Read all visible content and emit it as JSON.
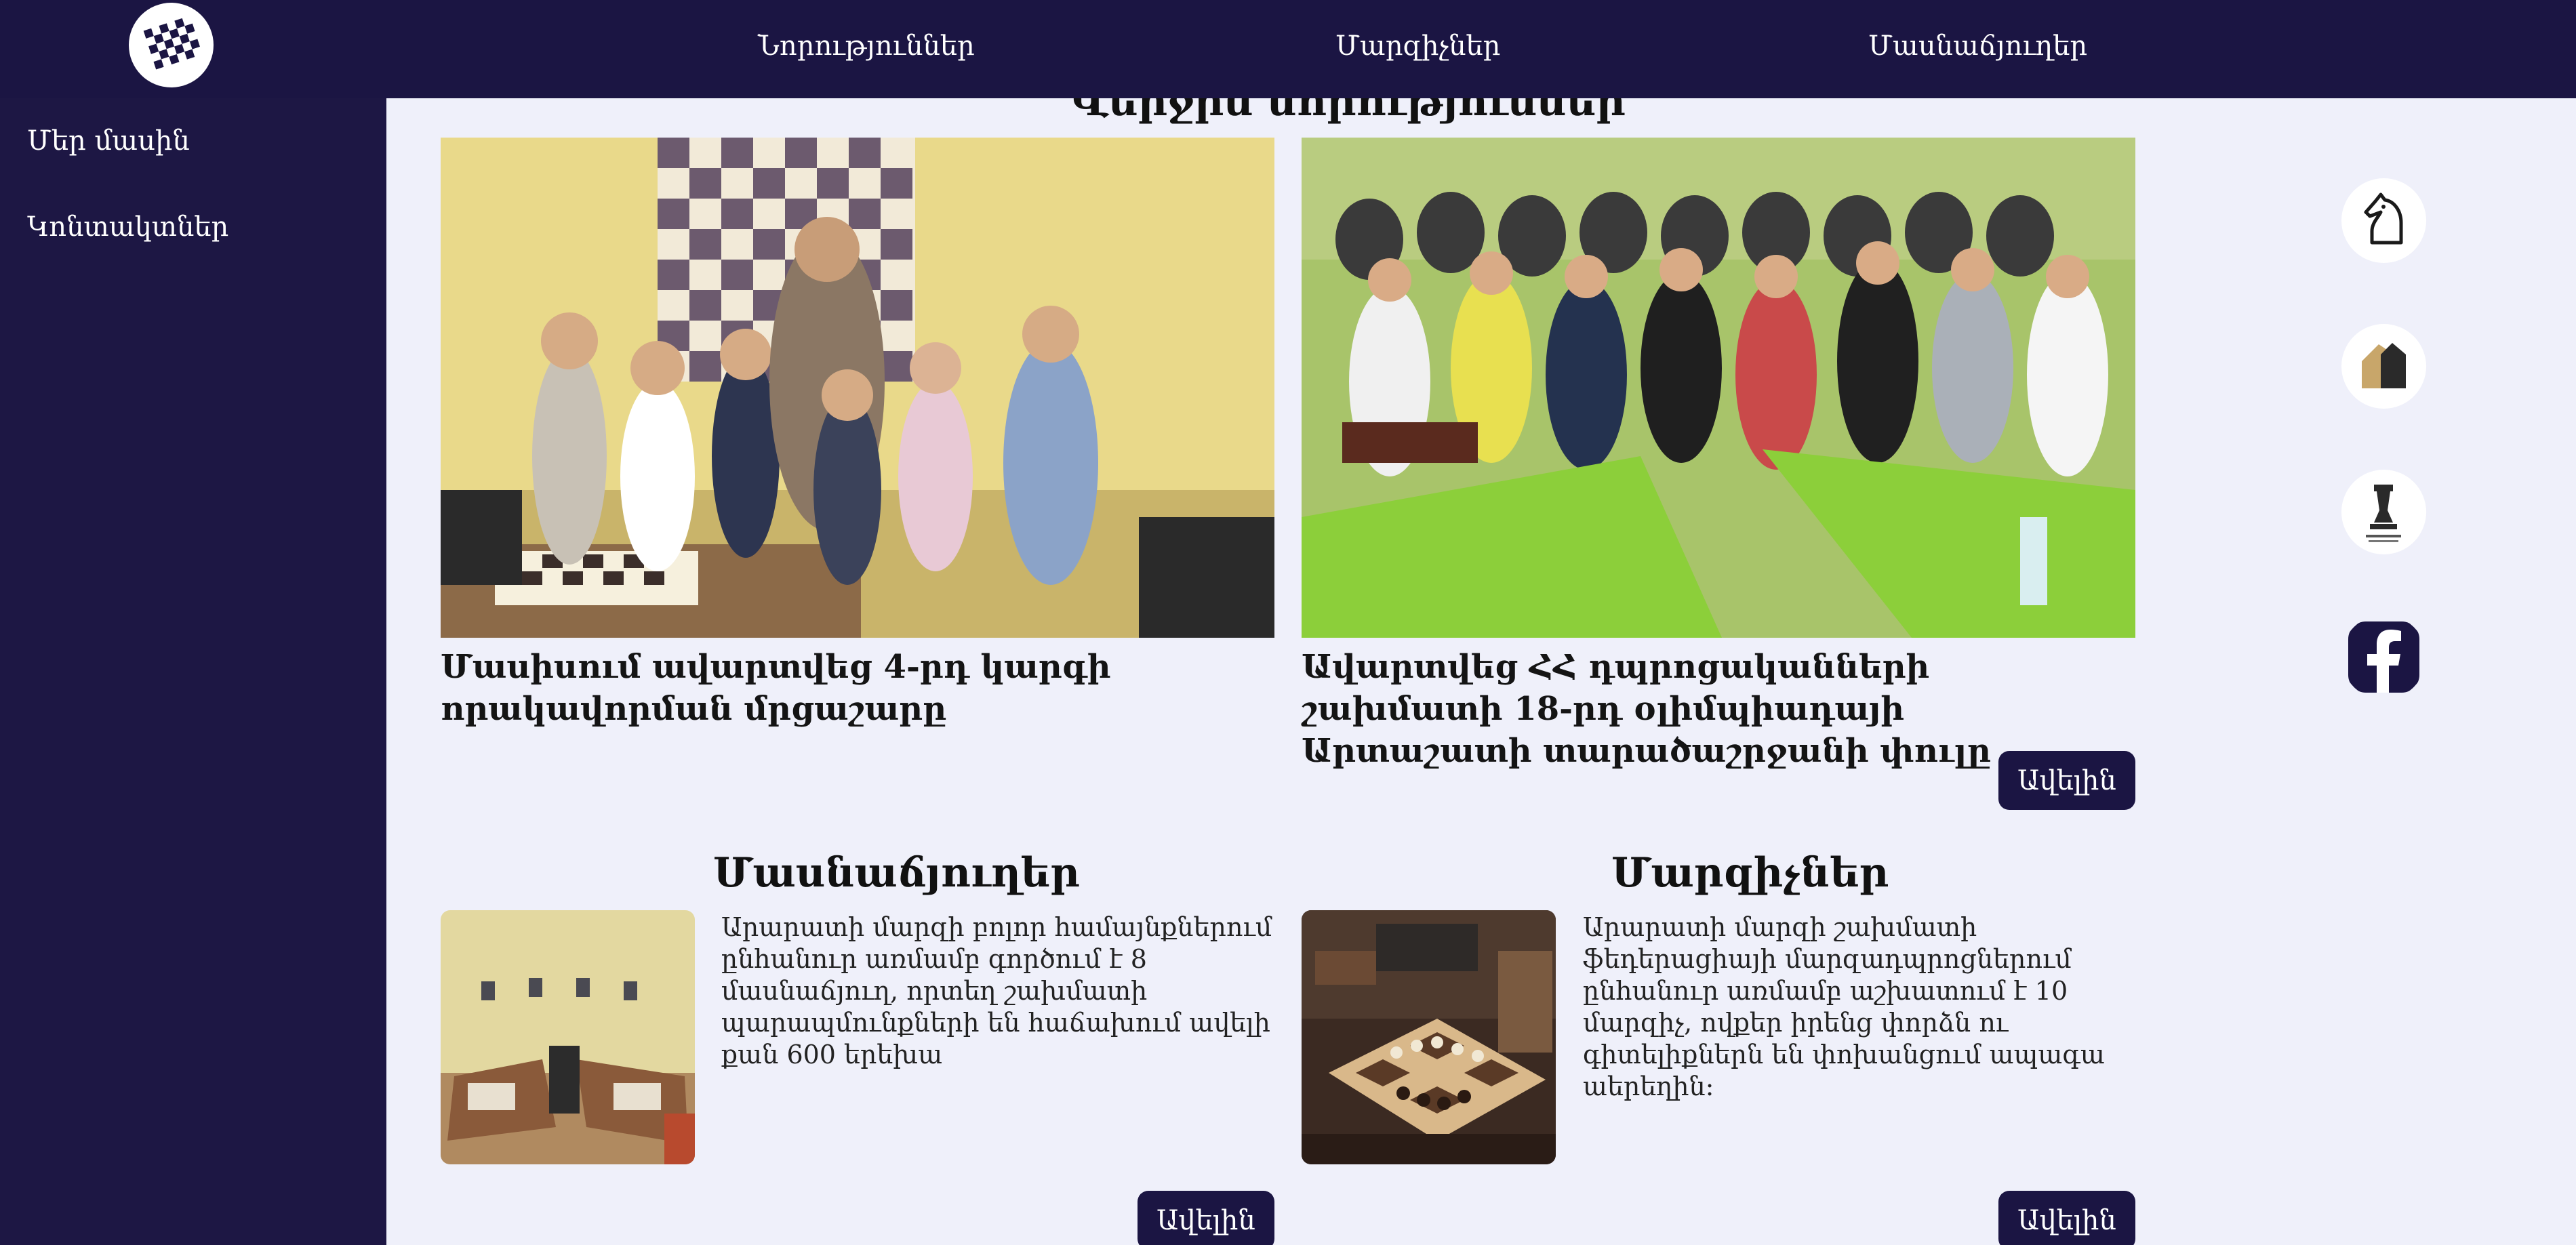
{
  "nav": {
    "news": "Նորություններ",
    "coaches": "Մարզիչներ",
    "branches": "Մասնաճյուղեր"
  },
  "sidebar": {
    "about": "Մեր մասին",
    "contacts": "Կոնտակտներ"
  },
  "news_section": {
    "title": "Վերջին նորություններ",
    "items": [
      {
        "title": "Մասիսում ավարտվեց 4-րդ կարգի որակավորման մրցաշարը"
      },
      {
        "title": "Ավարտվեց ՀՀ դպրոցականների շախմատի 18-րդ օլիմպիադայի Արտաշատի տարածաշրջանի փուլը"
      }
    ],
    "more": "Ավելին"
  },
  "branches_section": {
    "title": "Մասնաճյուղեր",
    "text": "Արարատի մարզի բոլոր համայնքներում ընհանուր առմամբ գործում է 8 մասնաճյուղ, որտեղ շախմատի պարապմունքների են հաճախում ավելի քան 600 երեխա",
    "more": "Ավելին"
  },
  "coaches_section": {
    "title": "Մարզիչներ",
    "text": "Արարատի մարզի շախմատի ֆեդերացիայի մարզադպրոցներում ընհանուր առմամբ աշխատում է 10 մարզիչ, ովքեր իրենց փորձն ու գիտելիքներն են փոխանցում ապագա աերեղին:",
    "more": "Ավելին"
  },
  "social": {
    "icons": [
      "knight-icon",
      "chess-pieces-icon",
      "federation-emblem-icon",
      "facebook-icon"
    ]
  },
  "colors": {
    "navy": "#1b1543",
    "content_bg": "#eff0fa",
    "facebook": "#1b1543"
  }
}
